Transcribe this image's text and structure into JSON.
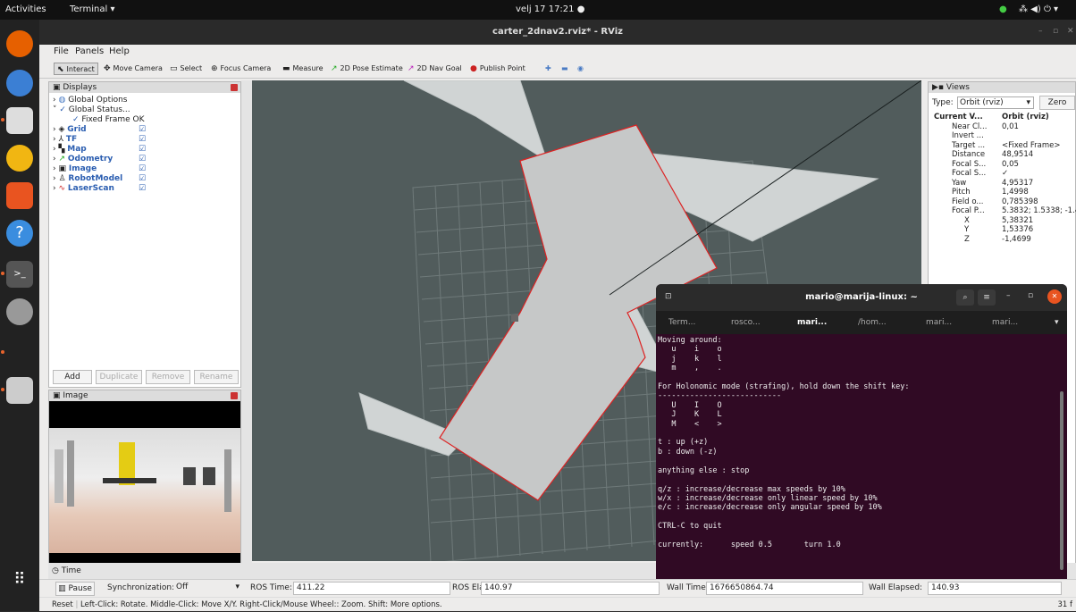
{
  "topbar": {
    "activities": "Activities",
    "app_menu": "Terminal ▾",
    "clock": "velj 17  17:21  ●"
  },
  "window": {
    "title": "carter_2dnav2.rviz* - RViz"
  },
  "menu": {
    "file": "File",
    "panels": "Panels",
    "help": "Help"
  },
  "toolbar": {
    "interact": "Interact",
    "move_camera": "Move Camera",
    "select": "Select",
    "focus_camera": "Focus Camera",
    "measure": "Measure",
    "pose_estimate": "2D Pose Estimate",
    "nav_goal": "2D Nav Goal",
    "publish_point": "Publish Point"
  },
  "displays": {
    "title": "Displays",
    "items": [
      {
        "label": "Global Options"
      },
      {
        "label": "Global Status..."
      },
      {
        "label": "Fixed Frame",
        "value": "OK"
      },
      {
        "label": "Grid"
      },
      {
        "label": "TF"
      },
      {
        "label": "Map"
      },
      {
        "label": "Odometry"
      },
      {
        "label": "Image"
      },
      {
        "label": "RobotModel"
      },
      {
        "label": "LaserScan"
      }
    ],
    "buttons": {
      "add": "Add",
      "duplicate": "Duplicate",
      "remove": "Remove",
      "rename": "Rename"
    }
  },
  "image_panel": {
    "title": "Image"
  },
  "views": {
    "title": "Views",
    "type_label": "Type:",
    "type_value": "Orbit (rviz)",
    "zero": "Zero",
    "rows": [
      {
        "k": "Current V...",
        "v": "Orbit (rviz)"
      },
      {
        "k": "Near Cl...",
        "v": "0,01"
      },
      {
        "k": "Invert ...",
        "v": ""
      },
      {
        "k": "Target ...",
        "v": "<Fixed Frame>"
      },
      {
        "k": "Distance",
        "v": "48,9514"
      },
      {
        "k": "Focal S...",
        "v": "0,05"
      },
      {
        "k": "Focal S...",
        "v": "✓"
      },
      {
        "k": "Yaw",
        "v": "4,95317"
      },
      {
        "k": "Pitch",
        "v": "1,4998"
      },
      {
        "k": "Field o...",
        "v": "0,785398"
      },
      {
        "k": "Focal P...",
        "v": "5.3832; 1.5338; -1.4..."
      },
      {
        "k": "X",
        "v": "5,38321"
      },
      {
        "k": "Y",
        "v": "1,53376"
      },
      {
        "k": "Z",
        "v": "-1,4699"
      }
    ]
  },
  "terminal": {
    "title": "mario@marija-linux: ~",
    "tabs": [
      "Term...",
      "rosco...",
      "mari...",
      "/hom...",
      "mari...",
      "mari..."
    ],
    "body": "Moving around:\n   u    i    o\n   j    k    l\n   m    ,    .\n\nFor Holonomic mode (strafing), hold down the shift key:\n---------------------------\n   U    I    O\n   J    K    L\n   M    <    >\n\nt : up (+z)\nb : down (-z)\n\nanything else : stop\n\nq/z : increase/decrease max speeds by 10%\nw/x : increase/decrease only linear speed by 10%\ne/c : increase/decrease only angular speed by 10%\n\nCTRL-C to quit\n\ncurrently:      speed 0.5       turn 1.0"
  },
  "time": {
    "title": "Time",
    "pause": "Pause",
    "sync_label": "Synchronization:",
    "sync_value": "Off",
    "ros_time_label": "ROS Time:",
    "ros_time": "411.22",
    "ros_elapsed_label": "ROS Elapsed:",
    "ros_elapsed": "140.97",
    "wall_time_label": "Wall Time:",
    "wall_time": "1676650864.74",
    "wall_elapsed_label": "Wall Elapsed:",
    "wall_elapsed": "140.93"
  },
  "statusbar": {
    "reset": "Reset",
    "hint": "Left-Click: Rotate. Middle-Click: Move X/Y. Right-Click/Mouse Wheel:: Zoom. Shift: More options.",
    "fps": "31 f"
  }
}
